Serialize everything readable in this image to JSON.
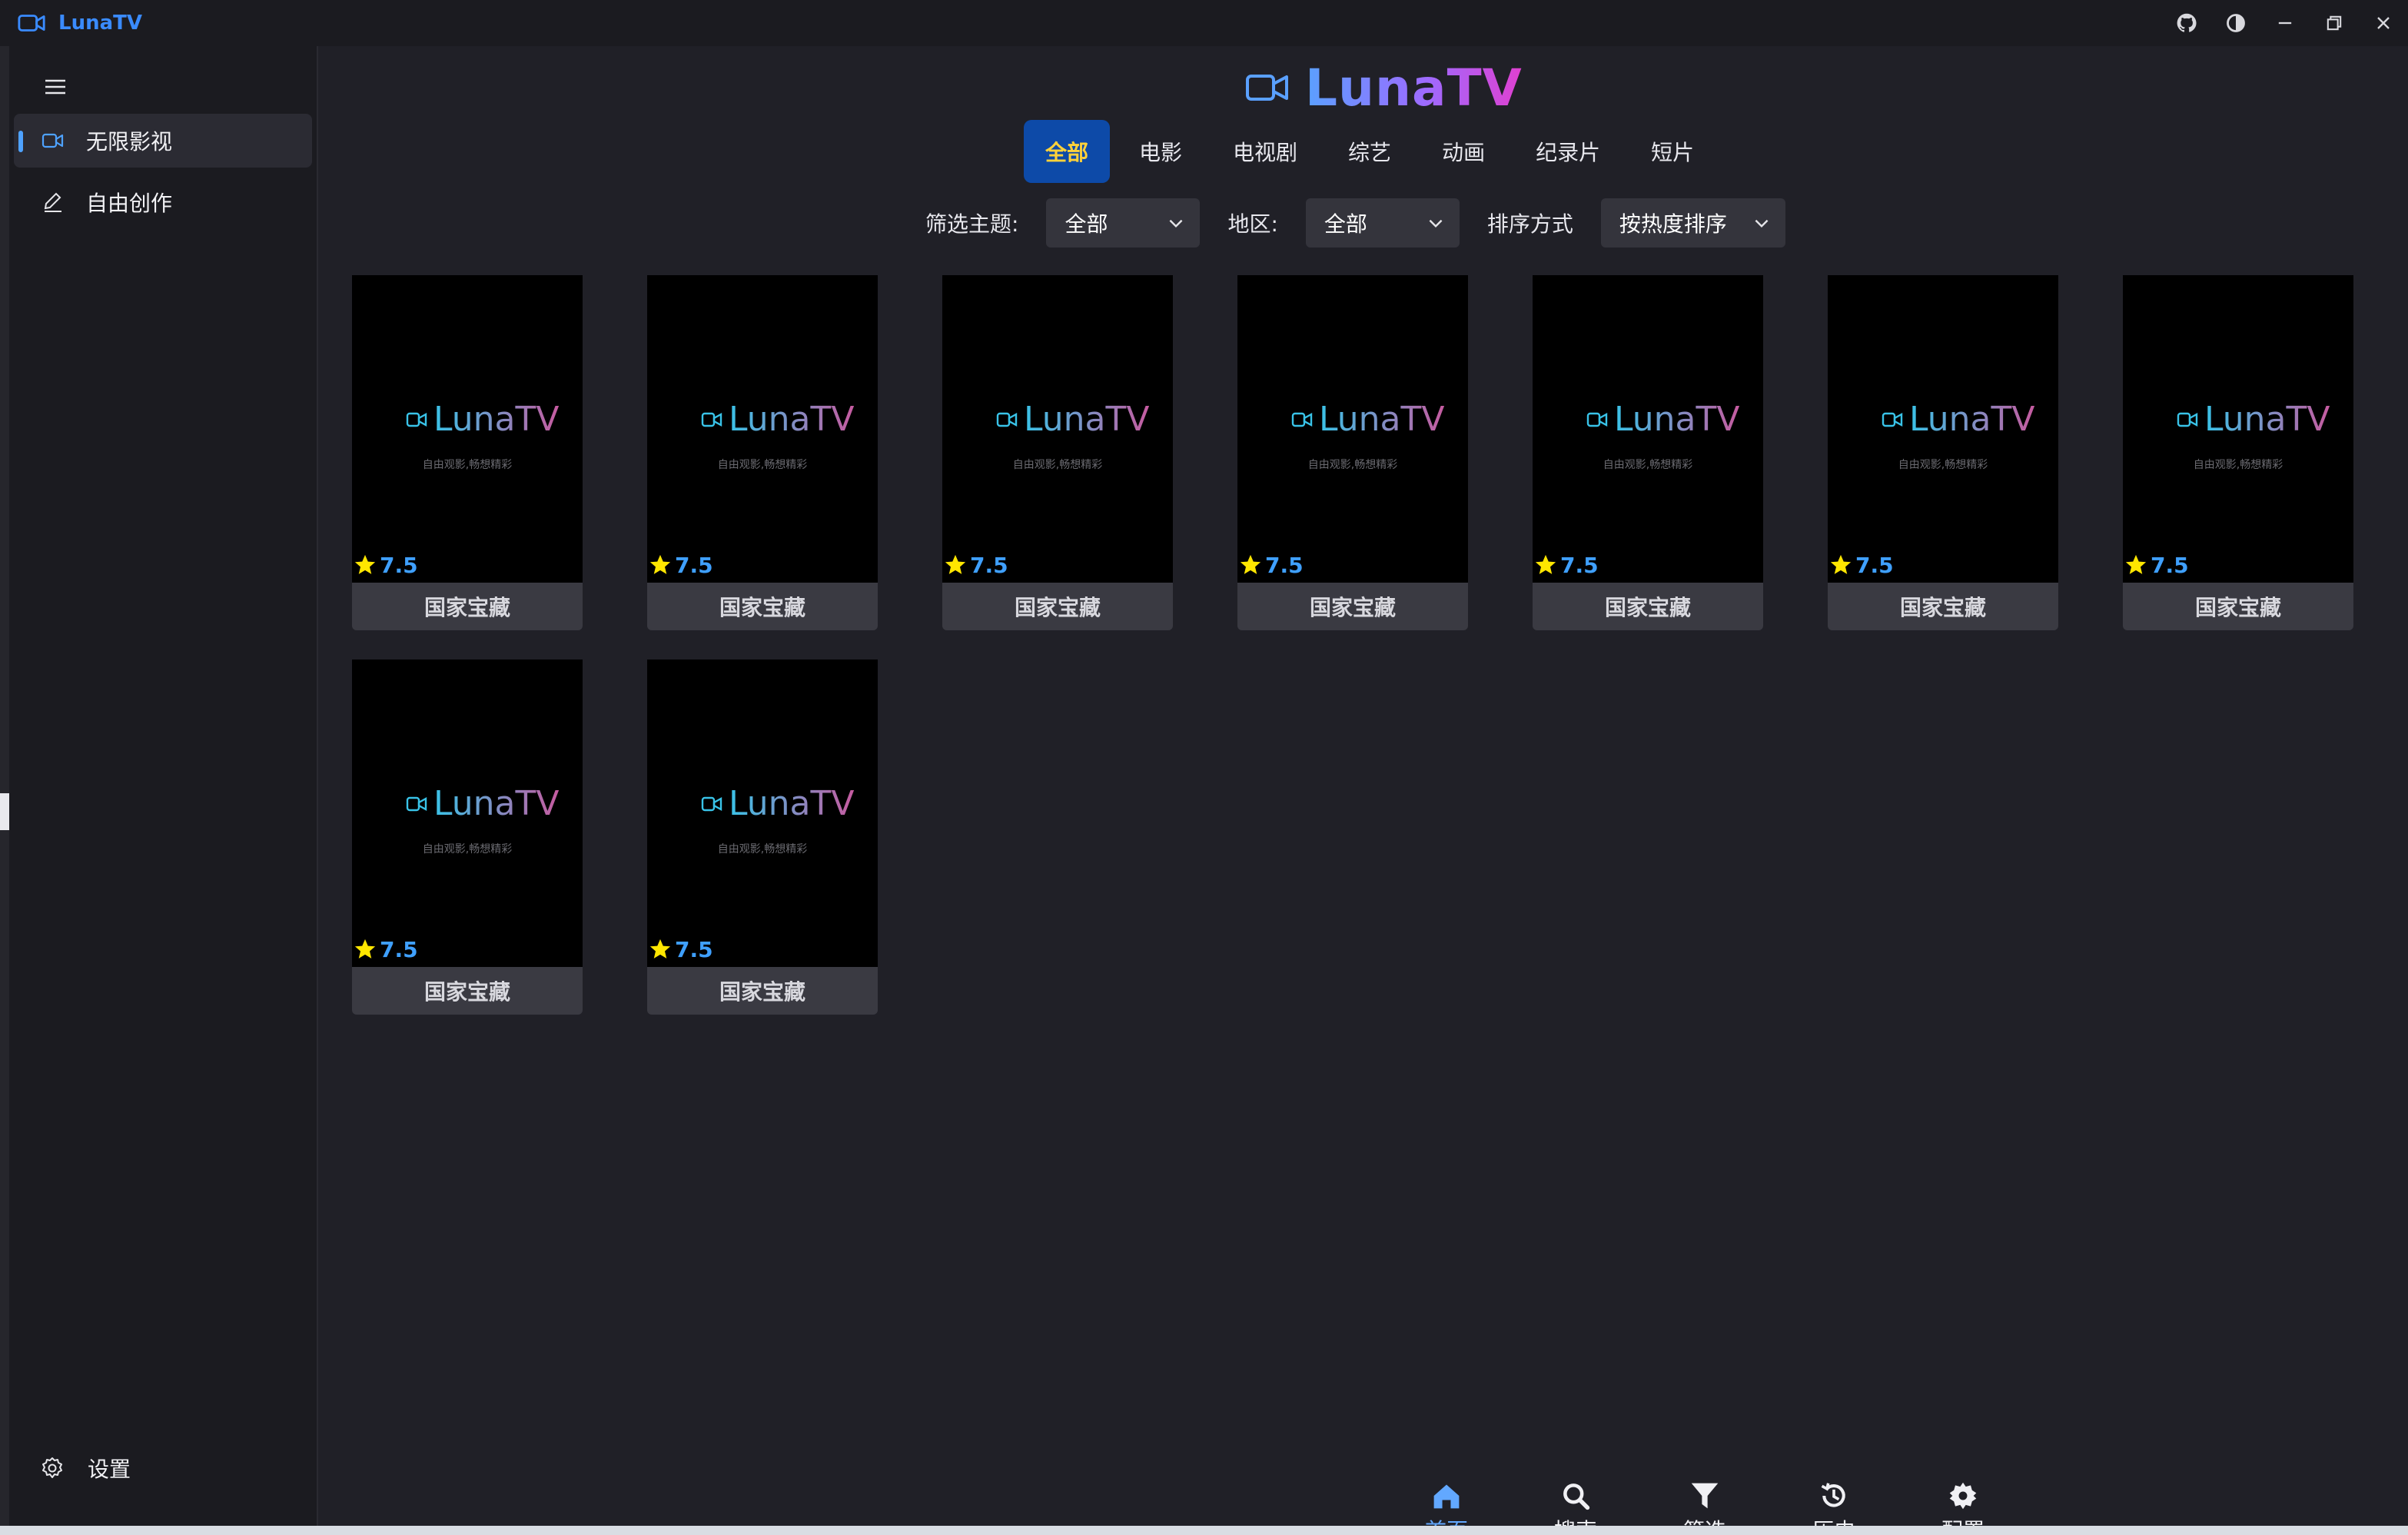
{
  "window": {
    "app_name": "LunaTV",
    "controls": [
      "github-icon",
      "theme-icon",
      "minimize-icon",
      "restore-icon",
      "close-icon"
    ]
  },
  "sidebar": {
    "items": [
      {
        "label": "无限影视",
        "icon": "video-camera-icon",
        "active": true
      },
      {
        "label": "自由创作",
        "icon": "pen-icon",
        "active": false
      }
    ],
    "settings_label": "设置"
  },
  "header": {
    "brand": "LunaTV"
  },
  "tabs": [
    {
      "label": "全部",
      "active": true
    },
    {
      "label": "电影",
      "active": false
    },
    {
      "label": "电视剧",
      "active": false
    },
    {
      "label": "综艺",
      "active": false
    },
    {
      "label": "动画",
      "active": false
    },
    {
      "label": "纪录片",
      "active": false
    },
    {
      "label": "短片",
      "active": false
    }
  ],
  "filters": {
    "theme_label": "筛选主题:",
    "theme_value": "全部",
    "region_label": "地区:",
    "region_value": "全部",
    "sort_label": "排序方式",
    "sort_value": "按热度排序"
  },
  "cards": [
    {
      "title": "国家宝藏",
      "rating": "7.5",
      "poster_brand": "LunaTV",
      "poster_slogan": "自由观影,畅想精彩"
    },
    {
      "title": "国家宝藏",
      "rating": "7.5",
      "poster_brand": "LunaTV",
      "poster_slogan": "自由观影,畅想精彩"
    },
    {
      "title": "国家宝藏",
      "rating": "7.5",
      "poster_brand": "LunaTV",
      "poster_slogan": "自由观影,畅想精彩"
    },
    {
      "title": "国家宝藏",
      "rating": "7.5",
      "poster_brand": "LunaTV",
      "poster_slogan": "自由观影,畅想精彩"
    },
    {
      "title": "国家宝藏",
      "rating": "7.5",
      "poster_brand": "LunaTV",
      "poster_slogan": "自由观影,畅想精彩"
    },
    {
      "title": "国家宝藏",
      "rating": "7.5",
      "poster_brand": "LunaTV",
      "poster_slogan": "自由观影,畅想精彩"
    },
    {
      "title": "国家宝藏",
      "rating": "7.5",
      "poster_brand": "LunaTV",
      "poster_slogan": "自由观影,畅想精彩"
    },
    {
      "title": "国家宝藏",
      "rating": "7.5",
      "poster_brand": "LunaTV",
      "poster_slogan": "自由观影,畅想精彩"
    },
    {
      "title": "国家宝藏",
      "rating": "7.5",
      "poster_brand": "LunaTV",
      "poster_slogan": "自由观影,畅想精彩"
    }
  ],
  "bottom_nav": [
    {
      "label": "首页",
      "icon": "home-icon",
      "active": true
    },
    {
      "label": "搜索",
      "icon": "search-icon",
      "active": false
    },
    {
      "label": "筛选",
      "icon": "filter-icon",
      "active": false
    },
    {
      "label": "历史",
      "icon": "history-icon",
      "active": false
    },
    {
      "label": "配置",
      "icon": "gear-icon",
      "active": false
    }
  ],
  "colors": {
    "accent": "#62a8ff",
    "active_tab_bg": "#0d4aa8",
    "active_tab_text": "#ffd23a",
    "rating_text": "#3fa0ff",
    "star": "#ffe600"
  }
}
